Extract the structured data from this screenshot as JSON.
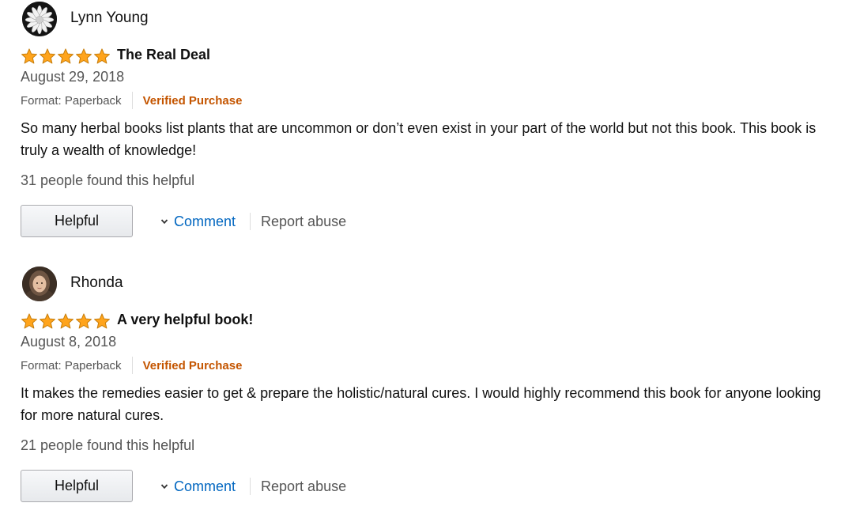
{
  "colors": {
    "star": "#ffa41c",
    "verified": "#c45500",
    "link": "#0066c0",
    "muted_text": "#555555"
  },
  "reviews": [
    {
      "reviewer": "Lynn Young",
      "avatar_icon": "flower-icon",
      "rating": 5,
      "rating_max": 5,
      "title": "The Real Deal",
      "date": "August 29, 2018",
      "format": "Format: Paperback",
      "verified": "Verified Purchase",
      "body": "So many herbal books list plants that are uncommon or don’t even exist in your part of the world but not this book. This book is truly a wealth of knowledge!",
      "helpful_count": "31 people found this helpful",
      "helpful_button": "Helpful",
      "comment_link": "Comment",
      "report_link": "Report abuse"
    },
    {
      "reviewer": "Rhonda",
      "avatar_icon": "user-photo-icon",
      "rating": 5,
      "rating_max": 5,
      "title": "A very helpful book!",
      "date": "August 8, 2018",
      "format": "Format: Paperback",
      "verified": "Verified Purchase",
      "body": "It makes the remedies easier to get & prepare the holistic/natural cures. I would highly recommend this book for anyone looking for more natural cures.",
      "helpful_count": "21 people found this helpful",
      "helpful_button": "Helpful",
      "comment_link": "Comment",
      "report_link": "Report abuse"
    }
  ]
}
